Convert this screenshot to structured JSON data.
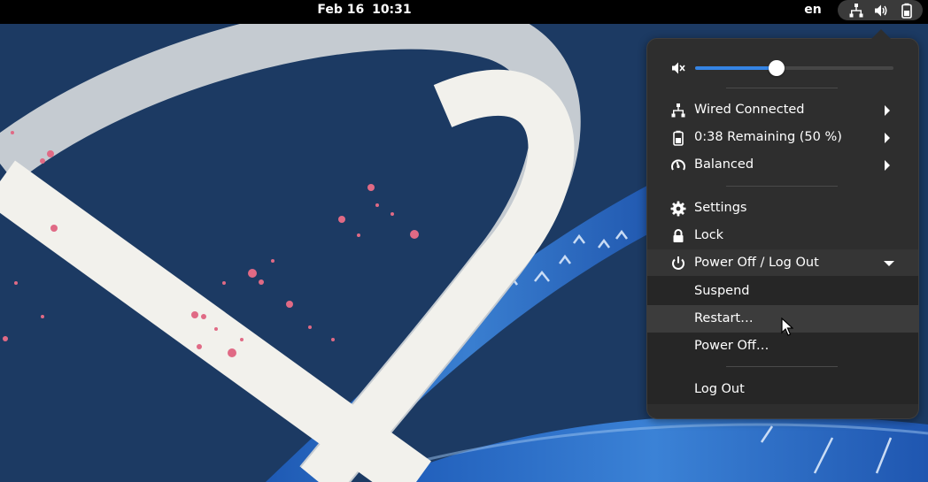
{
  "topbar": {
    "date": "Feb 16",
    "time": "10:31",
    "input_language": "en",
    "tray_icons": [
      "network-wired-icon",
      "speaker-icon",
      "battery-icon"
    ]
  },
  "menu": {
    "volume": {
      "icon": "speaker-muted-icon",
      "level_fraction": 0.41
    },
    "items": [
      {
        "icon": "network-wired-icon",
        "label": "Wired Connected",
        "submenu": true
      },
      {
        "icon": "battery-icon",
        "label": "0:38 Remaining (50 %)",
        "submenu": true
      },
      {
        "icon": "power-profile-icon",
        "label": "Balanced",
        "submenu": true
      }
    ],
    "actions": [
      {
        "icon": "gear-icon",
        "label": "Settings"
      },
      {
        "icon": "lock-icon",
        "label": "Lock"
      }
    ],
    "power": {
      "icon": "power-icon",
      "label": "Power Off / Log Out",
      "expanded": true,
      "submenu": [
        {
          "label": "Suspend"
        },
        {
          "label": "Restart…",
          "hovered": true
        },
        {
          "label": "Power Off…"
        }
      ],
      "logout_label": "Log Out"
    }
  },
  "colors": {
    "accent": "#3584e4",
    "menu_bg": "#2e2e2e",
    "topbar_bg": "#000000",
    "wallpaper_bg": "#1c3a63"
  }
}
